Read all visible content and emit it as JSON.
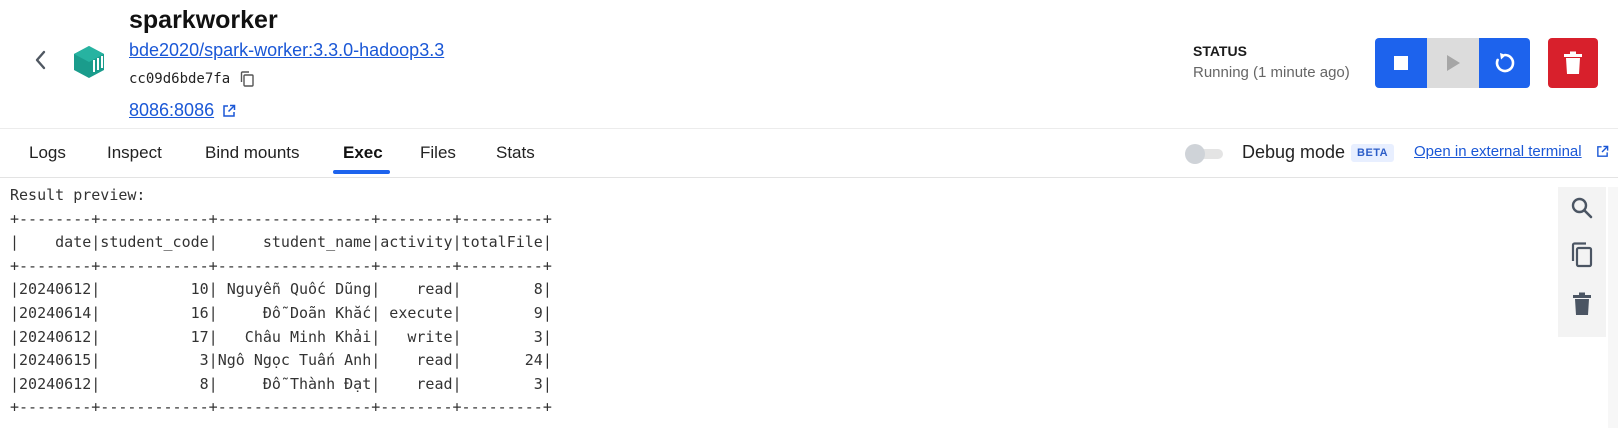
{
  "container": {
    "name": "sparkworker",
    "image": "bde2020/spark-worker:3.3.0-hadoop3.3",
    "id": "cc09d6bde7fa",
    "port": "8086:8086"
  },
  "status": {
    "label": "STATUS",
    "value": "Running (1 minute ago)"
  },
  "tabs": [
    {
      "label": "Logs"
    },
    {
      "label": "Inspect"
    },
    {
      "label": "Bind mounts"
    },
    {
      "label": "Exec"
    },
    {
      "label": "Files"
    },
    {
      "label": "Stats"
    }
  ],
  "active_tab": "Exec",
  "debug": {
    "label": "Debug mode",
    "badge": "BETA",
    "external_link": "Open in external terminal",
    "enabled": false
  },
  "terminal": {
    "lines": [
      "Result preview:",
      "+--------+------------+-----------------+--------+---------+",
      "|    date|student_code|     student_name|activity|totalFile|",
      "+--------+------------+-----------------+--------+---------+",
      "|20240612|          10| Nguyễn Quốc Dũng|    read|        8|",
      "|20240614|          16|     Đỗ Doãn Khắc| execute|        9|",
      "|20240612|          17|   Châu Minh Khải|   write|        3|",
      "|20240615|           3|Ngô Ngọc Tuấn Anh|    read|       24|",
      "|20240612|           8|     Đỗ Thành Đạt|    read|        3|",
      "+--------+------------+-----------------+--------+---------+"
    ]
  },
  "colors": {
    "accent": "#1d63ed",
    "danger": "#d8202c",
    "container_icon": "#1a9c8c",
    "link": "#1a57d6"
  },
  "icons": [
    "chevron-left-icon",
    "container-icon",
    "copy-icon",
    "external-link-icon",
    "stop-icon",
    "play-icon",
    "restart-icon",
    "trash-icon",
    "search-icon"
  ]
}
